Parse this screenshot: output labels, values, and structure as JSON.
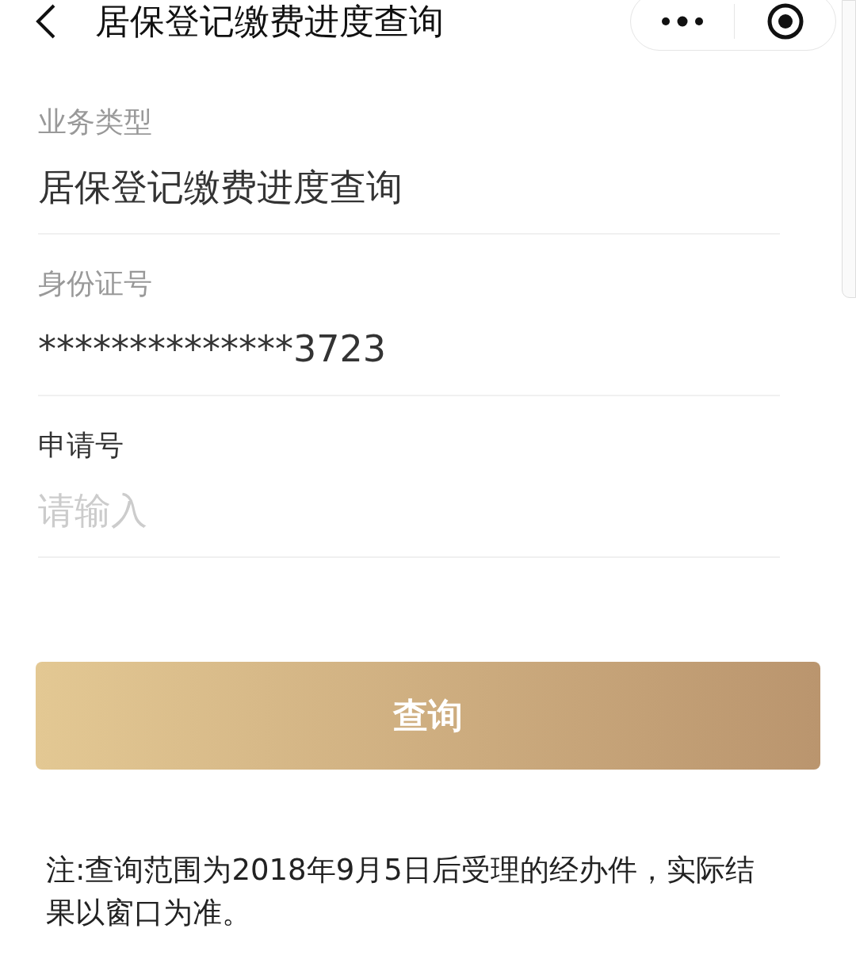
{
  "header": {
    "title": "居保登记缴费进度查询"
  },
  "fields": [
    {
      "label": "业务类型",
      "value": "居保登记缴费进度查询",
      "readonly": true
    },
    {
      "label": "身份证号",
      "value": "**************3723",
      "readonly": true
    },
    {
      "label": "申请号",
      "placeholder": "请输入",
      "readonly": false
    }
  ],
  "button": {
    "label": "查询"
  },
  "note": "注:查询范围为2018年9月5日后受理的经办件，实际结果以窗口为准。"
}
